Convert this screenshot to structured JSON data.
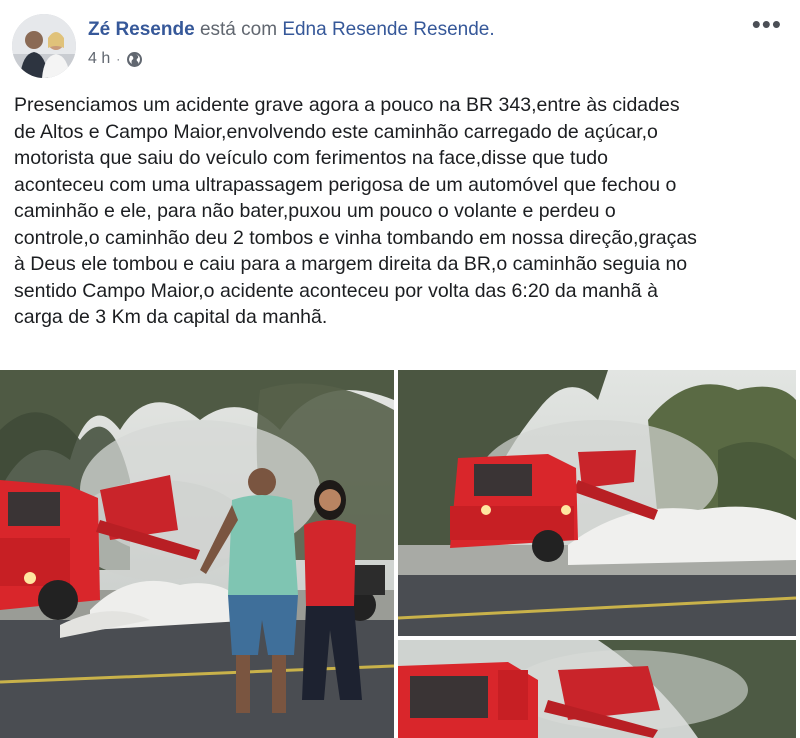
{
  "post": {
    "author": "Zé Resende",
    "with_text": "está com",
    "tagged": "Edna Resende Resende.",
    "time": "4 h",
    "dot": "·",
    "privacy_icon": "globe-icon",
    "more_icon": "more-icon",
    "more_glyph": "•••",
    "text": "Presenciamos um acidente grave agora a pouco na BR 343,entre às cidades\nde Altos e Campo Maior,envolvendo este caminhão carregado de açúcar,o\nmotorista que saiu do veículo com ferimentos na face,disse que tudo\naconteceu com uma ultrapassagem perigosa de um automóvel que fechou o\ncaminhão e ele, para não bater,puxou um pouco o volante e perdeu o\ncontrole,o caminhão deu 2 tombos e vinha tombando em nossa direção,graças\nà Deus ele tombou e caiu para a margem direita da BR,o caminhão seguia no\nsentido Campo Maior,o acidente aconteceu por volta das 6:20 da manhã à\ncarga de 3 Km da capital da manhã."
  },
  "colors": {
    "link": "#365899",
    "secondary": "#616770",
    "text": "#1c1e21",
    "truck_red": "#d9262b",
    "sky": "#d7dbd8",
    "road": "#4a4d52"
  }
}
